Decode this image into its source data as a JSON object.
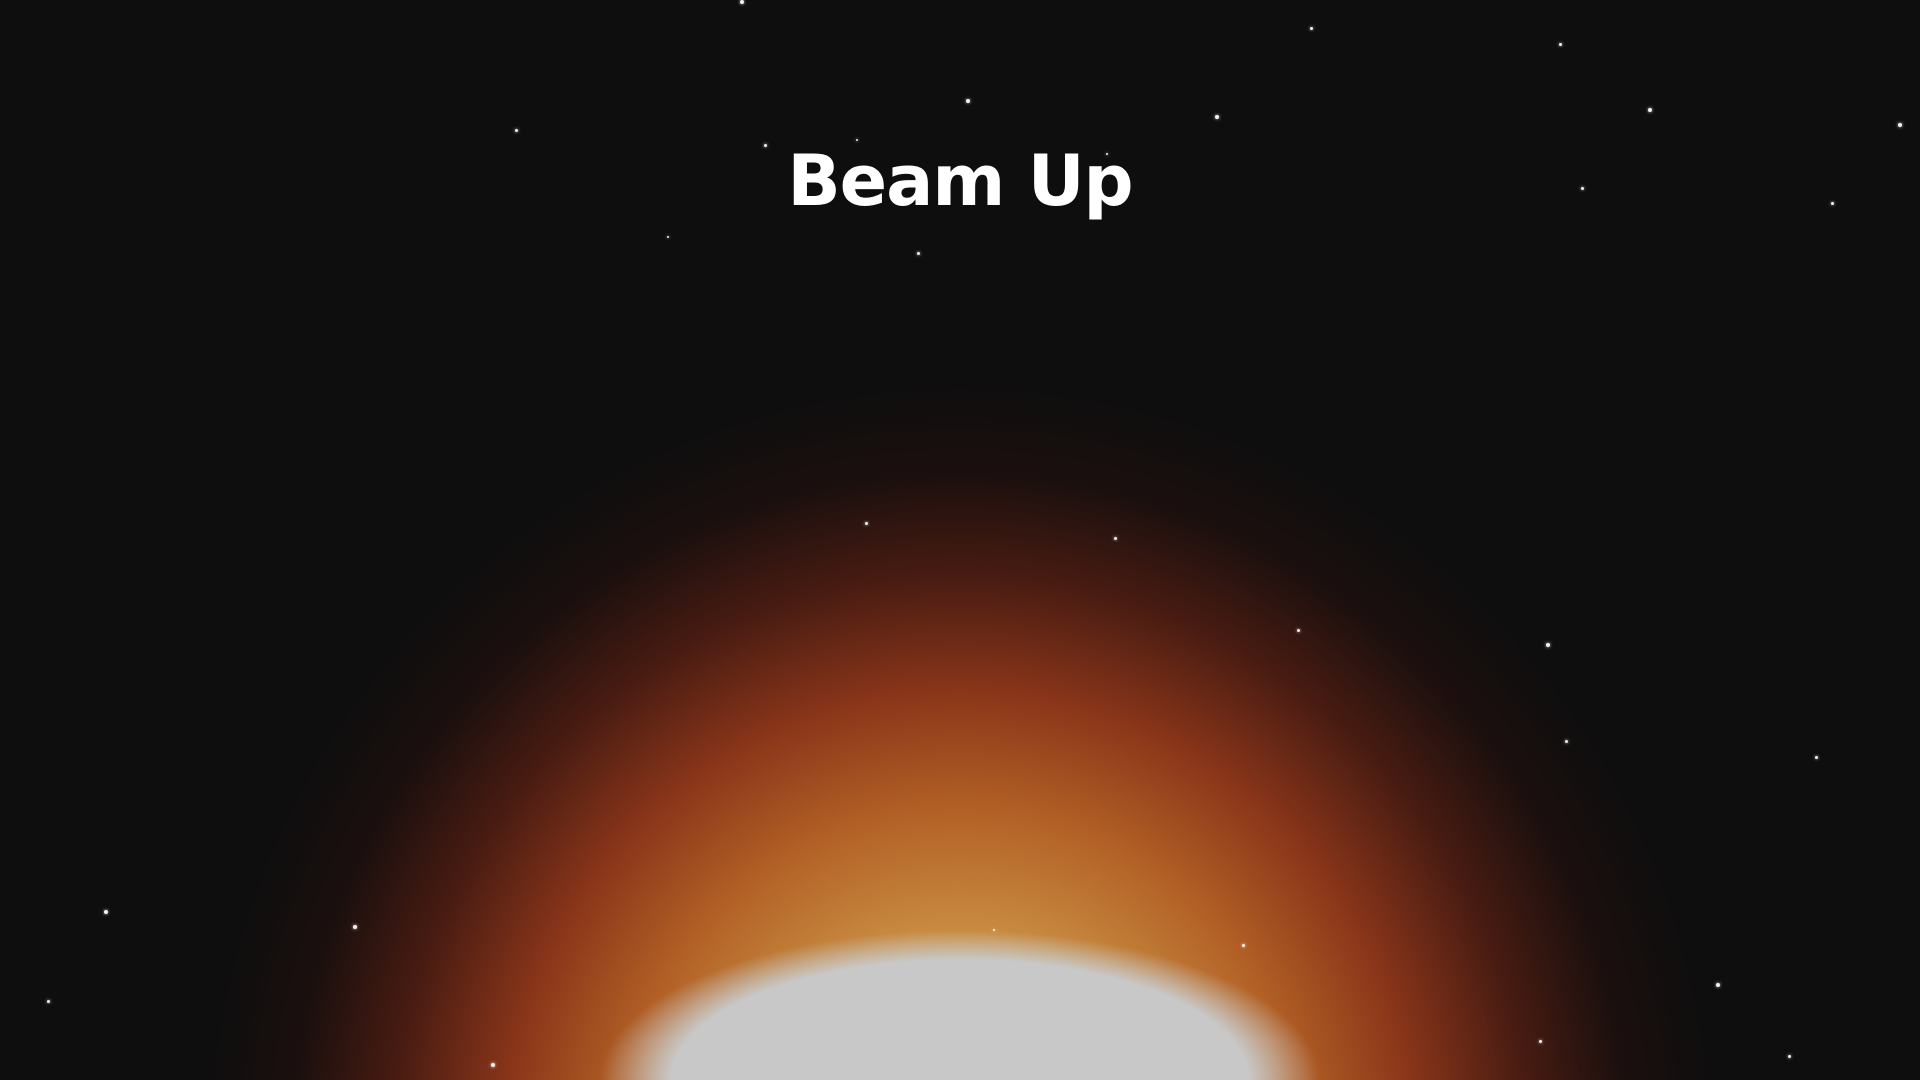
{
  "game": {
    "title": "Beam Up"
  },
  "colors": {
    "background": "#0e0e0e",
    "glow_core": "#c8c8c8",
    "glow_inner": "#d4964a",
    "glow_outer": "#a53e1c",
    "star": "#f2f2f2",
    "title_text": "#ffffff"
  }
}
